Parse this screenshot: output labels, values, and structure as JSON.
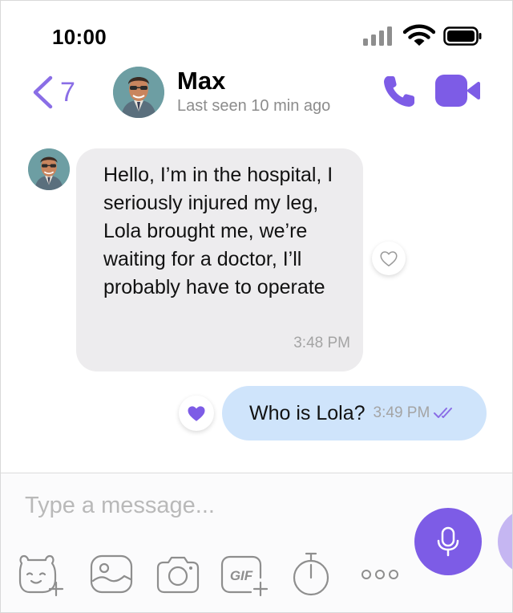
{
  "status_bar": {
    "time": "10:00"
  },
  "header": {
    "back_count": "7",
    "contact_name": "Max",
    "contact_status": "Last seen 10 min ago"
  },
  "messages": [
    {
      "direction": "incoming",
      "text": "Hello, I’m in the hospital, I seriously injured my leg, Lola brought me, we’re waiting for a doctor, I’ll probably have to operate",
      "time": "3:48 PM",
      "reaction": "heart-outline"
    },
    {
      "direction": "outgoing",
      "text": "Who is Lola?",
      "time": "3:49 PM",
      "reaction": "heart-filled",
      "status": "read"
    }
  ],
  "composer": {
    "placeholder": "Type a message...",
    "tools": [
      "sticker-icon",
      "gallery-icon",
      "camera-icon",
      "gif-icon",
      "timer-icon",
      "more-icon"
    ],
    "gif_label": "GIF"
  },
  "colors": {
    "accent": "#7d5ce6",
    "incoming_bubble": "#edecee",
    "outgoing_bubble": "#cfe4fb",
    "muted_text": "#a4a4a4"
  }
}
